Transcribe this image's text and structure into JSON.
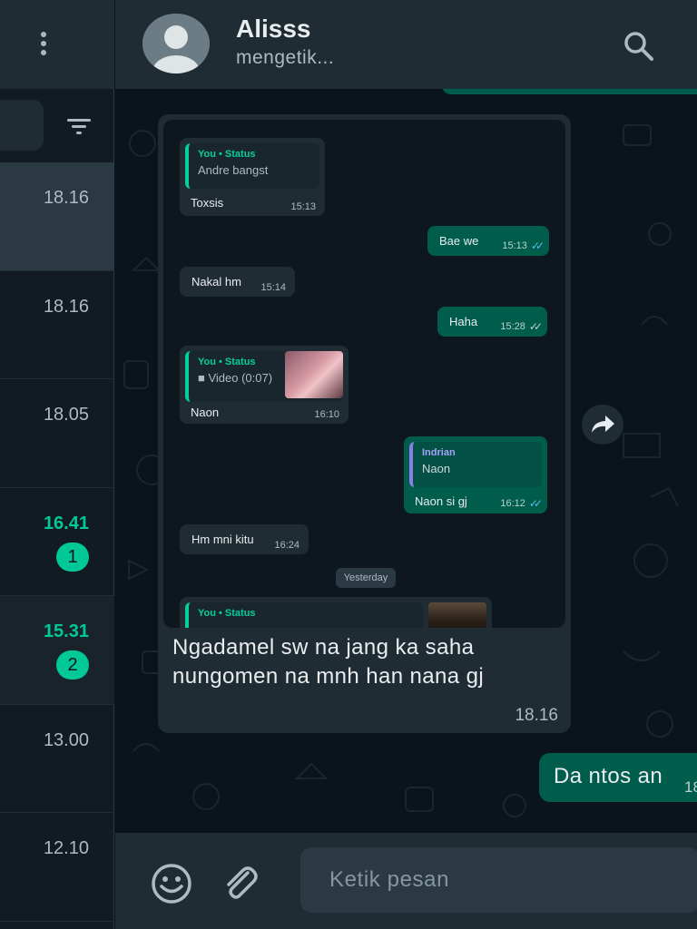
{
  "sidebar": {
    "rows": [
      {
        "time": "18.16",
        "unread": false,
        "badge": "",
        "state": "active"
      },
      {
        "time": "18.16",
        "unread": false,
        "badge": "",
        "state": ""
      },
      {
        "time": "18.05",
        "unread": false,
        "badge": "",
        "state": ""
      },
      {
        "time": "16.41",
        "unread": true,
        "badge": "1",
        "state": ""
      },
      {
        "time": "15.31",
        "unread": true,
        "badge": "2",
        "state": "dim"
      },
      {
        "time": "13.00",
        "unread": false,
        "badge": "",
        "state": ""
      },
      {
        "time": "12.10",
        "unread": false,
        "badge": "",
        "state": ""
      }
    ]
  },
  "header": {
    "name": "Alisss",
    "status": "mengetik..."
  },
  "message": {
    "caption": "Ngadamel sw na jang ka saha nungomen na mnh han nana gj",
    "time": "18.16",
    "screenshot": {
      "b1": {
        "q_author": "You • Status",
        "q_text": "Andre bangst",
        "text": "Toxsis",
        "time": "15:13"
      },
      "b2": {
        "text": "Bae we",
        "time": "15:13"
      },
      "b3": {
        "text": "Nakal hm",
        "time": "15:14"
      },
      "b4": {
        "text": "Haha",
        "time": "15:28"
      },
      "b5": {
        "q_author": "You • Status",
        "q_text": "■ Video (0:07)",
        "text": "Naon",
        "time": "16:10"
      },
      "b6": {
        "q_author": "Indrian",
        "q_text": "Naon",
        "text": "Naon si gj",
        "time": "16:12"
      },
      "b7": {
        "text": "Hm mni kitu",
        "time": "16:24"
      },
      "day": "Yesterday",
      "b8": {
        "q_author": "You • Status"
      }
    }
  },
  "outgoing": {
    "text": "Da ntos an",
    "time": "18"
  },
  "footer": {
    "placeholder": "Ketik pesan"
  },
  "colors": {
    "accent": "#00c997",
    "outgoing_bubble": "#005c4b",
    "incoming_bubble": "#202c33",
    "read_ticks": "#53bdeb"
  }
}
